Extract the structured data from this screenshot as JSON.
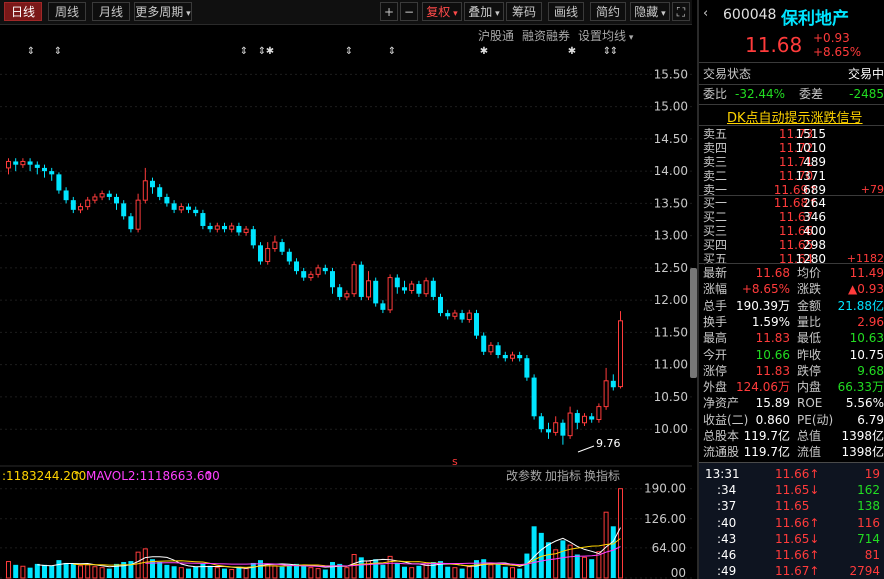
{
  "toolbar": {
    "tabs": [
      "日线",
      "周线",
      "月线",
      "更多周期"
    ],
    "plus": "+",
    "minus": "−",
    "buttons": [
      "复权",
      "叠加",
      "筹码",
      "画线",
      "简约",
      "隐藏"
    ]
  },
  "subbar": {
    "items": [
      "沪股通",
      "融资融券",
      "设置均线"
    ]
  },
  "price_axis": [
    "15.50",
    "15.00",
    "14.50",
    "14.00",
    "13.50",
    "13.00",
    "12.50",
    "12.00",
    "11.50",
    "11.00",
    "10.50",
    "10.00"
  ],
  "low_label": "9.76",
  "marker_s": "s",
  "vol_legend": {
    "mavol1": ":1183244.200",
    "mavol2": "MAVOL2:1118663.600"
  },
  "vol_buttons": [
    "改参数",
    "加指标",
    "换指标"
  ],
  "vol_axis": [
    "190.00",
    "126.00",
    "64.00",
    "00"
  ],
  "colors": {
    "up": "#ff3b3b",
    "down": "#00e5ff",
    "ma1": "#ffffff",
    "ma2": "#ffd400",
    "ma3": "#ff40ff"
  },
  "quote": {
    "code": "600048",
    "name": "保利地产",
    "price": "11.68",
    "change": "+0.93",
    "pct": "+8.65%",
    "status_label": "交易状态",
    "status_value": "交易中",
    "weibi_label": "委比",
    "weibi_value": "-32.44%",
    "weicha_label": "委差",
    "weicha_value": "-2485",
    "signal_link": "DK点自动提示涨跌信号",
    "sell": [
      {
        "label": "卖五",
        "price": "11.73",
        "vol": "1515",
        "chg": ""
      },
      {
        "label": "卖四",
        "price": "11.72",
        "vol": "1010",
        "chg": ""
      },
      {
        "label": "卖三",
        "price": "11.71",
        "vol": "489",
        "chg": ""
      },
      {
        "label": "卖二",
        "price": "11.70",
        "vol": "1371",
        "chg": ""
      },
      {
        "label": "卖一",
        "price": "11.69↑",
        "vol": "689",
        "chg": "+79"
      }
    ],
    "buy": [
      {
        "label": "买一",
        "price": "11.68↑",
        "vol": "264",
        "chg": ""
      },
      {
        "label": "买二",
        "price": "11.67",
        "vol": "346",
        "chg": ""
      },
      {
        "label": "买三",
        "price": "11.66",
        "vol": "400",
        "chg": ""
      },
      {
        "label": "买四",
        "price": "11.65",
        "vol": "298",
        "chg": ""
      },
      {
        "label": "买五",
        "price": "11.64",
        "vol": "1280",
        "chg": "+1182"
      }
    ],
    "stats": [
      [
        "最新",
        "11.68",
        "red",
        "均价",
        "11.49",
        "red"
      ],
      [
        "涨幅",
        "+8.65%",
        "red",
        "涨跌",
        "▲0.93",
        "red"
      ],
      [
        "总手",
        "190.39万",
        "white",
        "金额",
        "21.88亿",
        "cyan"
      ],
      [
        "换手",
        "1.59%",
        "white",
        "量比",
        "2.96",
        "red"
      ],
      [
        "最高",
        "11.83",
        "red",
        "最低",
        "10.63",
        "green"
      ],
      [
        "今开",
        "10.66",
        "green",
        "昨收",
        "10.75",
        "white"
      ],
      [
        "涨停",
        "11.83",
        "red",
        "跌停",
        "9.68",
        "green"
      ],
      [
        "外盘",
        "124.06万",
        "red",
        "内盘",
        "66.33万",
        "green"
      ],
      [
        "净资产",
        "15.89",
        "white",
        "ROE",
        "5.56%",
        "white"
      ],
      [
        "收益(二)",
        "0.860",
        "white",
        "PE(动)",
        "6.79",
        "white"
      ],
      [
        "总股本",
        "119.7亿",
        "white",
        "总值",
        "1398亿",
        "white"
      ],
      [
        "流通股",
        "119.7亿",
        "white",
        "流值",
        "1398亿",
        "white"
      ]
    ],
    "ticks": [
      {
        "time": "13:31",
        "price": "11.66↑",
        "vol": "19",
        "pc": "red",
        "vc": "red"
      },
      {
        "time": ":34",
        "price": "11.65↓",
        "vol": "162",
        "pc": "red",
        "vc": "green"
      },
      {
        "time": ":37",
        "price": "11.65",
        "vol": "138",
        "pc": "red",
        "vc": "green"
      },
      {
        "time": ":40",
        "price": "11.66↑",
        "vol": "116",
        "pc": "red",
        "vc": "red"
      },
      {
        "time": ":43",
        "price": "11.65↓",
        "vol": "714",
        "pc": "red",
        "vc": "green"
      },
      {
        "time": ":46",
        "price": "11.66↑",
        "vol": "81",
        "pc": "red",
        "vc": "red"
      },
      {
        "time": ":49",
        "price": "11.67↑",
        "vol": "2794",
        "pc": "red",
        "vc": "red"
      }
    ]
  },
  "chart_data": {
    "type": "candlestick",
    "price_range": [
      9.6,
      15.8
    ],
    "volume_range": [
      0,
      200
    ],
    "candles": [
      {
        "o": 14.05,
        "c": 14.15,
        "h": 14.2,
        "l": 13.95,
        "v": 35
      },
      {
        "o": 14.15,
        "c": 14.1,
        "h": 14.2,
        "l": 14.0,
        "v": 28
      },
      {
        "o": 14.1,
        "c": 14.15,
        "h": 14.2,
        "l": 14.05,
        "v": 25
      },
      {
        "o": 14.15,
        "c": 14.1,
        "h": 14.2,
        "l": 14.0,
        "v": 22
      },
      {
        "o": 14.1,
        "c": 14.05,
        "h": 14.15,
        "l": 13.95,
        "v": 30
      },
      {
        "o": 14.05,
        "c": 14.0,
        "h": 14.1,
        "l": 13.9,
        "v": 28
      },
      {
        "o": 14.0,
        "c": 13.95,
        "h": 14.05,
        "l": 13.85,
        "v": 26
      },
      {
        "o": 13.95,
        "c": 13.7,
        "h": 13.98,
        "l": 13.65,
        "v": 38
      },
      {
        "o": 13.7,
        "c": 13.55,
        "h": 13.75,
        "l": 13.5,
        "v": 32
      },
      {
        "o": 13.55,
        "c": 13.4,
        "h": 13.6,
        "l": 13.35,
        "v": 30
      },
      {
        "o": 13.4,
        "c": 13.45,
        "h": 13.5,
        "l": 13.35,
        "v": 26
      },
      {
        "o": 13.45,
        "c": 13.55,
        "h": 13.6,
        "l": 13.4,
        "v": 28
      },
      {
        "o": 13.55,
        "c": 13.6,
        "h": 13.65,
        "l": 13.5,
        "v": 24
      },
      {
        "o": 13.6,
        "c": 13.65,
        "h": 13.7,
        "l": 13.55,
        "v": 22
      },
      {
        "o": 13.65,
        "c": 13.6,
        "h": 13.7,
        "l": 13.55,
        "v": 20
      },
      {
        "o": 13.6,
        "c": 13.5,
        "h": 13.65,
        "l": 13.4,
        "v": 30
      },
      {
        "o": 13.5,
        "c": 13.3,
        "h": 13.55,
        "l": 13.25,
        "v": 34
      },
      {
        "o": 13.3,
        "c": 13.1,
        "h": 13.35,
        "l": 13.05,
        "v": 36
      },
      {
        "o": 13.1,
        "c": 13.55,
        "h": 13.65,
        "l": 13.05,
        "v": 55
      },
      {
        "o": 13.55,
        "c": 13.85,
        "h": 14.05,
        "l": 13.5,
        "v": 62
      },
      {
        "o": 13.85,
        "c": 13.75,
        "h": 13.9,
        "l": 13.65,
        "v": 40
      },
      {
        "o": 13.75,
        "c": 13.6,
        "h": 13.8,
        "l": 13.55,
        "v": 34
      },
      {
        "o": 13.6,
        "c": 13.5,
        "h": 13.65,
        "l": 13.45,
        "v": 28
      },
      {
        "o": 13.5,
        "c": 13.4,
        "h": 13.55,
        "l": 13.35,
        "v": 25
      },
      {
        "o": 13.4,
        "c": 13.45,
        "h": 13.5,
        "l": 13.35,
        "v": 22
      },
      {
        "o": 13.45,
        "c": 13.4,
        "h": 13.5,
        "l": 13.35,
        "v": 20
      },
      {
        "o": 13.4,
        "c": 13.35,
        "h": 13.45,
        "l": 13.3,
        "v": 24
      },
      {
        "o": 13.35,
        "c": 13.15,
        "h": 13.4,
        "l": 13.1,
        "v": 30
      },
      {
        "o": 13.15,
        "c": 13.1,
        "h": 13.2,
        "l": 13.05,
        "v": 26
      },
      {
        "o": 13.1,
        "c": 13.15,
        "h": 13.2,
        "l": 13.05,
        "v": 22
      },
      {
        "o": 13.15,
        "c": 13.1,
        "h": 13.2,
        "l": 13.05,
        "v": 20
      },
      {
        "o": 13.1,
        "c": 13.15,
        "h": 13.2,
        "l": 13.05,
        "v": 18
      },
      {
        "o": 13.15,
        "c": 13.05,
        "h": 13.2,
        "l": 13.0,
        "v": 24
      },
      {
        "o": 13.05,
        "c": 13.1,
        "h": 13.15,
        "l": 13.0,
        "v": 20
      },
      {
        "o": 13.1,
        "c": 12.85,
        "h": 13.15,
        "l": 12.8,
        "v": 32
      },
      {
        "o": 12.85,
        "c": 12.6,
        "h": 12.9,
        "l": 12.55,
        "v": 38
      },
      {
        "o": 12.6,
        "c": 12.8,
        "h": 12.9,
        "l": 12.55,
        "v": 30
      },
      {
        "o": 12.8,
        "c": 12.9,
        "h": 13.0,
        "l": 12.75,
        "v": 26
      },
      {
        "o": 12.9,
        "c": 12.75,
        "h": 12.95,
        "l": 12.7,
        "v": 24
      },
      {
        "o": 12.75,
        "c": 12.6,
        "h": 12.8,
        "l": 12.55,
        "v": 28
      },
      {
        "o": 12.6,
        "c": 12.45,
        "h": 12.65,
        "l": 12.4,
        "v": 30
      },
      {
        "o": 12.45,
        "c": 12.35,
        "h": 12.5,
        "l": 12.3,
        "v": 26
      },
      {
        "o": 12.35,
        "c": 12.4,
        "h": 12.45,
        "l": 12.3,
        "v": 22
      },
      {
        "o": 12.4,
        "c": 12.5,
        "h": 12.55,
        "l": 12.35,
        "v": 20
      },
      {
        "o": 12.5,
        "c": 12.45,
        "h": 12.55,
        "l": 12.4,
        "v": 18
      },
      {
        "o": 12.45,
        "c": 12.2,
        "h": 12.5,
        "l": 12.1,
        "v": 34
      },
      {
        "o": 12.2,
        "c": 12.05,
        "h": 12.25,
        "l": 12.0,
        "v": 30
      },
      {
        "o": 12.05,
        "c": 12.1,
        "h": 12.15,
        "l": 12.0,
        "v": 22
      },
      {
        "o": 12.1,
        "c": 12.55,
        "h": 12.6,
        "l": 12.05,
        "v": 50
      },
      {
        "o": 12.55,
        "c": 12.05,
        "h": 12.6,
        "l": 12.0,
        "v": 44
      },
      {
        "o": 12.05,
        "c": 12.3,
        "h": 12.45,
        "l": 12.0,
        "v": 36
      },
      {
        "o": 12.3,
        "c": 11.95,
        "h": 12.35,
        "l": 11.9,
        "v": 40
      },
      {
        "o": 11.95,
        "c": 11.85,
        "h": 12.0,
        "l": 11.8,
        "v": 28
      },
      {
        "o": 11.85,
        "c": 12.35,
        "h": 12.4,
        "l": 11.8,
        "v": 46
      },
      {
        "o": 12.35,
        "c": 12.2,
        "h": 12.4,
        "l": 12.1,
        "v": 32
      },
      {
        "o": 12.2,
        "c": 12.15,
        "h": 12.3,
        "l": 12.1,
        "v": 24
      },
      {
        "o": 12.15,
        "c": 12.25,
        "h": 12.3,
        "l": 12.1,
        "v": 22
      },
      {
        "o": 12.25,
        "c": 12.1,
        "h": 12.3,
        "l": 12.05,
        "v": 26
      },
      {
        "o": 12.1,
        "c": 12.3,
        "h": 12.35,
        "l": 12.05,
        "v": 30
      },
      {
        "o": 12.3,
        "c": 12.05,
        "h": 12.35,
        "l": 12.0,
        "v": 34
      },
      {
        "o": 12.05,
        "c": 11.8,
        "h": 12.1,
        "l": 11.75,
        "v": 36
      },
      {
        "o": 11.8,
        "c": 11.75,
        "h": 11.85,
        "l": 11.7,
        "v": 24
      },
      {
        "o": 11.75,
        "c": 11.8,
        "h": 11.85,
        "l": 11.7,
        "v": 22
      },
      {
        "o": 11.8,
        "c": 11.7,
        "h": 11.85,
        "l": 11.65,
        "v": 20
      },
      {
        "o": 11.7,
        "c": 11.8,
        "h": 11.85,
        "l": 11.65,
        "v": 24
      },
      {
        "o": 11.8,
        "c": 11.45,
        "h": 11.85,
        "l": 11.4,
        "v": 38
      },
      {
        "o": 11.45,
        "c": 11.2,
        "h": 11.5,
        "l": 11.15,
        "v": 40
      },
      {
        "o": 11.2,
        "c": 11.3,
        "h": 11.35,
        "l": 11.15,
        "v": 28
      },
      {
        "o": 11.3,
        "c": 11.15,
        "h": 11.35,
        "l": 11.1,
        "v": 30
      },
      {
        "o": 11.15,
        "c": 11.1,
        "h": 11.2,
        "l": 11.05,
        "v": 24
      },
      {
        "o": 11.1,
        "c": 11.15,
        "h": 11.2,
        "l": 11.05,
        "v": 22
      },
      {
        "o": 11.15,
        "c": 11.1,
        "h": 11.2,
        "l": 11.05,
        "v": 20
      },
      {
        "o": 11.1,
        "c": 10.8,
        "h": 11.15,
        "l": 10.75,
        "v": 52
      },
      {
        "o": 10.8,
        "c": 10.2,
        "h": 10.85,
        "l": 10.15,
        "v": 110
      },
      {
        "o": 10.2,
        "c": 10.0,
        "h": 10.25,
        "l": 9.95,
        "v": 96
      },
      {
        "o": 10.0,
        "c": 9.95,
        "h": 10.1,
        "l": 9.85,
        "v": 76
      },
      {
        "o": 9.95,
        "c": 10.1,
        "h": 10.2,
        "l": 9.9,
        "v": 60
      },
      {
        "o": 10.1,
        "c": 9.9,
        "h": 10.15,
        "l": 9.76,
        "v": 80
      },
      {
        "o": 9.9,
        "c": 10.25,
        "h": 10.35,
        "l": 9.85,
        "v": 70
      },
      {
        "o": 10.25,
        "c": 10.1,
        "h": 10.3,
        "l": 10.0,
        "v": 50
      },
      {
        "o": 10.1,
        "c": 10.2,
        "h": 10.25,
        "l": 10.05,
        "v": 44
      },
      {
        "o": 10.2,
        "c": 10.15,
        "h": 10.25,
        "l": 10.1,
        "v": 40
      },
      {
        "o": 10.15,
        "c": 10.35,
        "h": 10.4,
        "l": 10.1,
        "v": 56
      },
      {
        "o": 10.35,
        "c": 10.75,
        "h": 10.95,
        "l": 10.3,
        "v": 140
      },
      {
        "o": 10.75,
        "c": 10.65,
        "h": 10.85,
        "l": 10.6,
        "v": 110
      },
      {
        "o": 10.66,
        "c": 11.68,
        "h": 11.83,
        "l": 10.63,
        "v": 190
      }
    ]
  }
}
